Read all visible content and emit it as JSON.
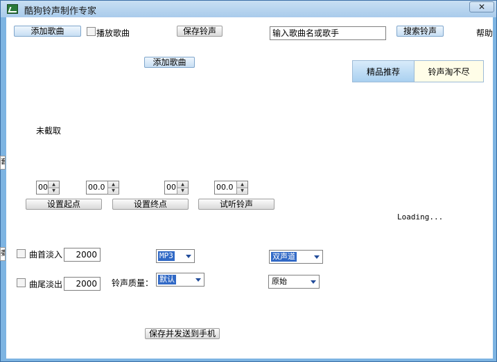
{
  "window": {
    "title": "酷狗铃声制作专家",
    "close_label": "✕"
  },
  "toolbar": {
    "add_song": "添加歌曲",
    "play_song": "播放歌曲",
    "save_ringtone": "保存铃声",
    "search_input": "输入歌曲名或歌手",
    "search_ringtone": "搜索铃声",
    "help": "帮助"
  },
  "main": {
    "add_song_center": "添加歌曲",
    "status": "未截取",
    "loading": "Loading..."
  },
  "tabs": [
    {
      "label": "精品推荐"
    },
    {
      "label": "铃声淘不尽"
    }
  ],
  "trim": {
    "start_min": "00",
    "start_sec": "00.0",
    "end_min": "00",
    "end_sec": "00.0",
    "set_start": "设置起点",
    "set_end": "设置终点",
    "preview": "试听铃声"
  },
  "fade": {
    "fade_in_label": "曲首淡入",
    "fade_in_value": "2000",
    "fade_out_label": "曲尾淡出",
    "fade_out_value": "2000"
  },
  "quality": {
    "label": "铃声质量：",
    "format": "MP3",
    "quality": "默认",
    "channel": "双声道",
    "sample": "原始"
  },
  "actions": {
    "save_send": "保存并发送到手机"
  },
  "left_strip": {
    "top_char": "套",
    "bottom_char": "委"
  }
}
